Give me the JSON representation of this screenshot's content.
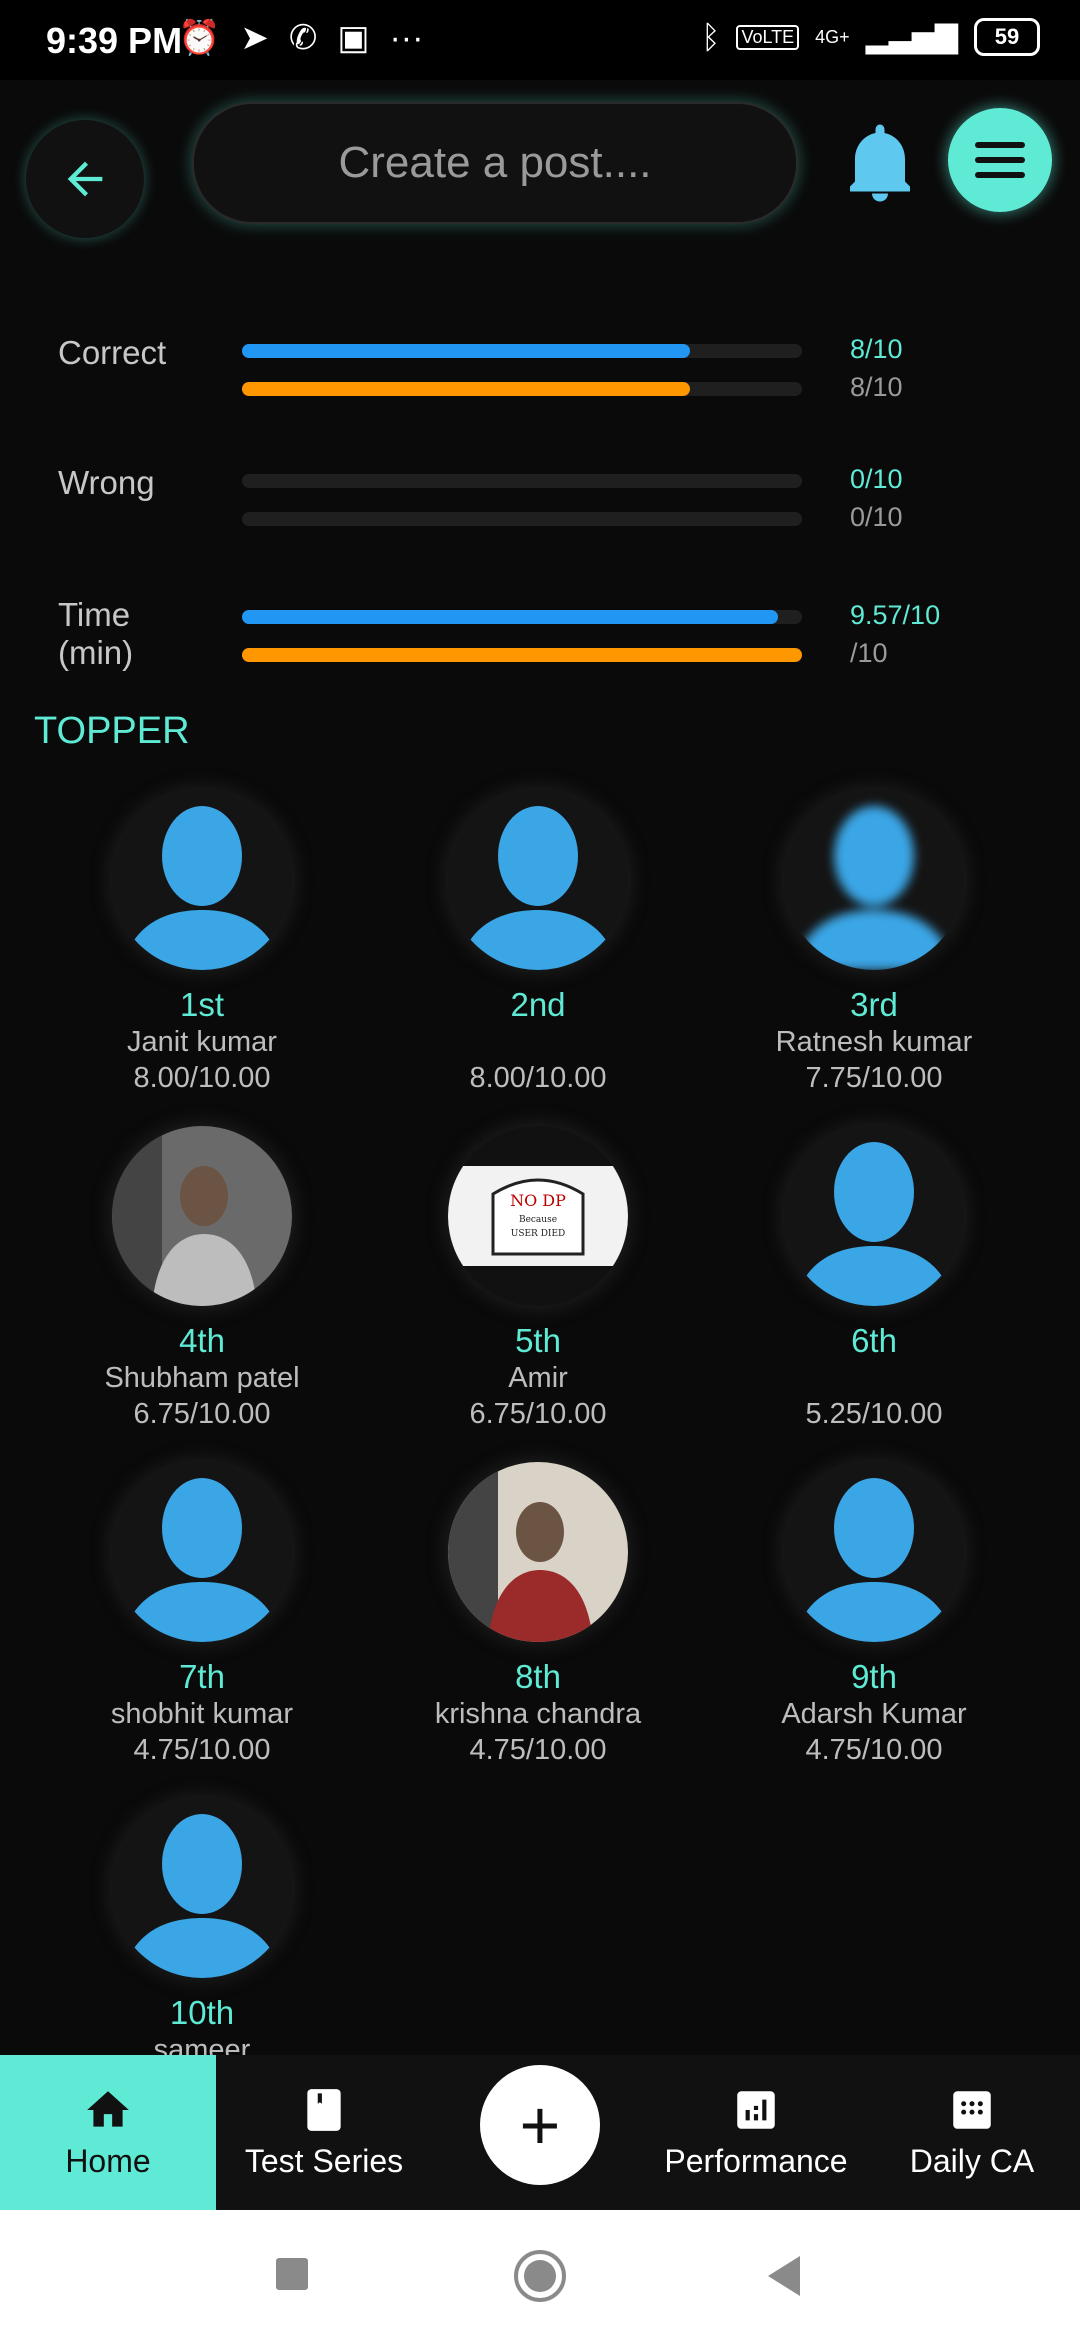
{
  "status_bar": {
    "time": "9:39 PM",
    "network": "4G+",
    "battery": "59"
  },
  "header": {
    "post_placeholder": "Create a post...."
  },
  "stats": [
    {
      "label": "Correct",
      "bars": [
        {
          "color": "blue",
          "fraction": 0.8
        },
        {
          "color": "orange",
          "fraction": 0.8
        }
      ],
      "values": [
        "8/10",
        "8/10"
      ]
    },
    {
      "label": "Wrong",
      "bars": [
        {
          "color": "blue",
          "fraction": 0.0
        },
        {
          "color": "orange",
          "fraction": 0.0
        }
      ],
      "values": [
        "0/10",
        "0/10"
      ]
    },
    {
      "label": "Time (min)",
      "bars": [
        {
          "color": "blue",
          "fraction": 0.957
        },
        {
          "color": "orange",
          "fraction": 1.0
        }
      ],
      "values": [
        "9.57/10",
        "/10"
      ]
    }
  ],
  "topper": {
    "title": "TOPPER",
    "users": [
      {
        "rank": "1st",
        "name": "Janit kumar",
        "score": "8.00/10.00",
        "avatar": "default"
      },
      {
        "rank": "2nd",
        "name": "",
        "score": "8.00/10.00",
        "avatar": "default"
      },
      {
        "rank": "3rd",
        "name": "Ratnesh kumar",
        "score": "7.75/10.00",
        "avatar": "blurred"
      },
      {
        "rank": "4th",
        "name": "Shubham patel",
        "score": "6.75/10.00",
        "avatar": "photo-man-bw"
      },
      {
        "rank": "5th",
        "name": "Amir",
        "score": "6.75/10.00",
        "avatar": "no-dp-sign"
      },
      {
        "rank": "6th",
        "name": "",
        "score": "5.25/10.00",
        "avatar": "default"
      },
      {
        "rank": "7th",
        "name": "shobhit kumar",
        "score": "4.75/10.00",
        "avatar": "default"
      },
      {
        "rank": "8th",
        "name": "krishna chandra",
        "score": "4.75/10.00",
        "avatar": "photo-man-red"
      },
      {
        "rank": "9th",
        "name": "Adarsh Kumar",
        "score": "4.75/10.00",
        "avatar": "default"
      },
      {
        "rank": "10th",
        "name": "sameer",
        "score": "",
        "avatar": "default"
      }
    ],
    "no_dp_text": [
      "NO DP",
      "Because",
      "USER DIED"
    ]
  },
  "bottom_nav": {
    "home": "Home",
    "test_series": "Test Series",
    "add": "+",
    "performance": "Performance",
    "daily_ca": "Daily CA"
  },
  "colors": {
    "accent": "#5eead4",
    "blue": "#2196f3",
    "orange": "#ff9800",
    "avatar_blue": "#3aa6e6"
  }
}
